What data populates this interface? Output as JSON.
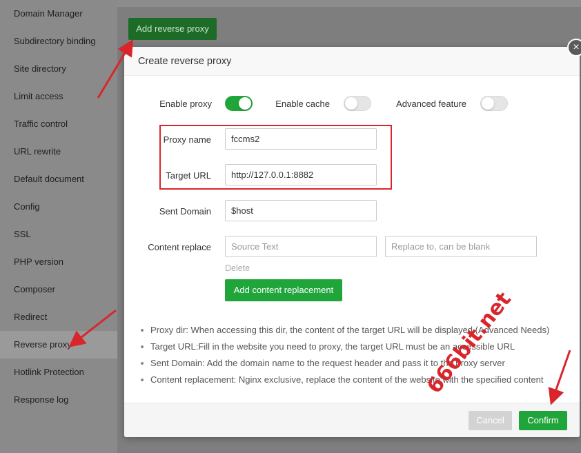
{
  "sidebar": {
    "items": [
      {
        "label": "Domain Manager"
      },
      {
        "label": "Subdirectory binding"
      },
      {
        "label": "Site directory"
      },
      {
        "label": "Limit access"
      },
      {
        "label": "Traffic control"
      },
      {
        "label": "URL rewrite"
      },
      {
        "label": "Default document"
      },
      {
        "label": "Config"
      },
      {
        "label": "SSL"
      },
      {
        "label": "PHP version"
      },
      {
        "label": "Composer"
      },
      {
        "label": "Redirect"
      },
      {
        "label": "Reverse proxy"
      },
      {
        "label": "Hotlink Protection"
      },
      {
        "label": "Response log"
      }
    ],
    "active": "Reverse proxy"
  },
  "toolbar": {
    "add_label": "Add reverse proxy"
  },
  "modal": {
    "title": "Create reverse proxy",
    "close_label": "×",
    "toggles": {
      "enable_proxy": {
        "label": "Enable proxy",
        "on": true
      },
      "enable_cache": {
        "label": "Enable cache",
        "on": false
      },
      "advanced": {
        "label": "Advanced feature",
        "on": false
      }
    },
    "fields": {
      "proxy_name": {
        "label": "Proxy name",
        "value": "fccms2"
      },
      "target_url": {
        "label": "Target URL",
        "value": "http://127.0.0.1:8882"
      },
      "sent_domain": {
        "label": "Sent Domain",
        "value": "$host"
      },
      "content_replace": {
        "label": "Content replace",
        "source_placeholder": "Source Text",
        "replace_placeholder": "Replace to, can be blank"
      }
    },
    "delete_label": "Delete",
    "add_replacement_label": "Add content replacement",
    "notes": [
      "Proxy dir: When accessing this dir, the content of the target URL will be displayed (Advanced Needs)",
      "Target URL:Fill in the website you need to proxy, the target URL must be an accessible URL",
      "Sent Domain: Add the domain name to the request header and pass it to the proxy server",
      "Content replacement: Nginx exclusive, replace the content of the website with the specified content"
    ],
    "cancel_label": "Cancel",
    "confirm_label": "Confirm"
  },
  "watermark": "666bit.net",
  "colors": {
    "accent_green": "#20a53a",
    "annotation_red": "#d9262c"
  }
}
